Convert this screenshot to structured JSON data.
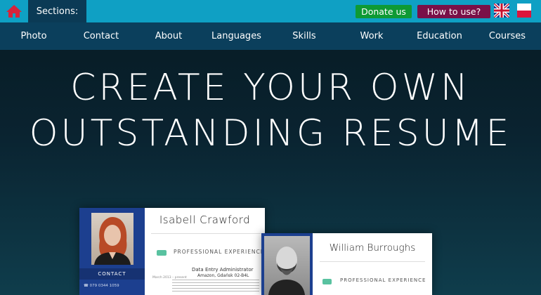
{
  "topbar": {
    "sections_label": "Sections:",
    "donate_label": "Donate us",
    "howto_label": "How to use?",
    "home_icon": "home-icon",
    "lang_en": "uk-flag-icon",
    "lang_pl": "pl-flag-icon"
  },
  "nav": {
    "items": [
      "Photo",
      "Contact",
      "About",
      "Languages",
      "Skills",
      "Work",
      "Education",
      "Courses"
    ]
  },
  "hero": {
    "line1": "CREATE YOUR OWN",
    "line2": "OUTSTANDING RESUME"
  },
  "preview1": {
    "name": "Isabell Crawford",
    "contact_label": "CONTACT",
    "phone": "079 0344 1059",
    "section": "PROFESSIONAL EXPERIENCE",
    "job_title": "Data Entry Administrator",
    "company": "Amazon, Gdańsk 02-B4L",
    "date": "March 2013 – present"
  },
  "preview2": {
    "name": "William Burroughs",
    "section": "PROFESSIONAL EXPERIENCE"
  },
  "colors": {
    "topbar": "#0fa0c4",
    "navbar": "#0b3f5c",
    "donate": "#0e9a34",
    "howto": "#7a1048",
    "resume_side": "#1c3f8f"
  }
}
